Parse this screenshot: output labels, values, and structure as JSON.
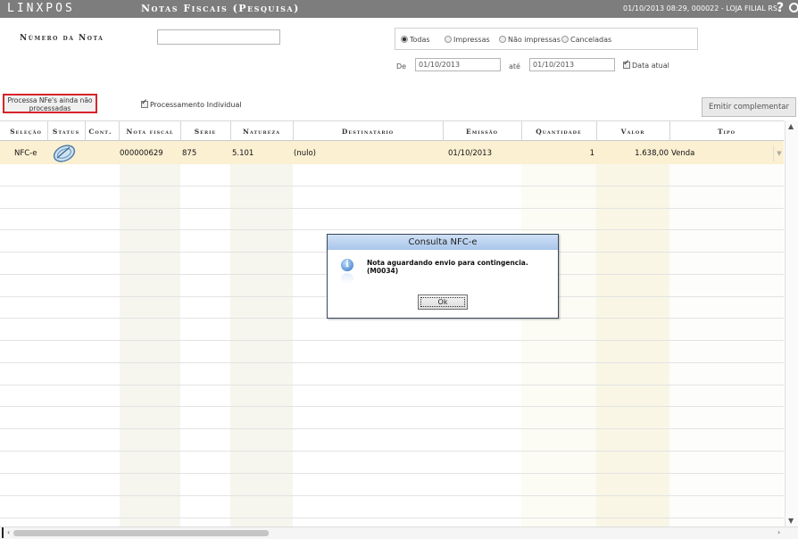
{
  "app": {
    "logo": "LINXPOS",
    "title": "Notas Fiscais (Pesquisa)",
    "info": "01/10/2013 08:29, 000022 - LOJA FILIAL RS."
  },
  "search": {
    "numero_label": "Número da Nota",
    "numero_value": ""
  },
  "filters": {
    "radios": [
      {
        "label": "Todas",
        "selected": true
      },
      {
        "label": "Impressas",
        "selected": false
      },
      {
        "label": "Não impressas",
        "selected": false
      },
      {
        "label": "Canceladas",
        "selected": false
      }
    ],
    "de_label": "De",
    "de_value": "01/10/2013",
    "ate_label": "até",
    "ate_value": "01/10/2013",
    "data_atual_label": "Data atual",
    "data_atual_checked": true
  },
  "actions": {
    "processa_label_line1": "Processa NFe's ainda não",
    "processa_label_line2": "processadas",
    "processamento_individual_label": "Processamento Individual",
    "processamento_individual_checked": true,
    "emitir_label": "Emitir complementar"
  },
  "table": {
    "headers": [
      "Seleção",
      "Status",
      "Cont.",
      "Nota fiscal",
      "Série",
      "Natureza",
      "Destinatário",
      "Emissão",
      "Quantidade",
      "Valor",
      "Tipo"
    ],
    "rows": [
      {
        "selecao": "NFC-e",
        "status_icon": "nfe-status-icon",
        "cont": "",
        "nota_fiscal": "000000629",
        "serie": "875",
        "natureza": "5.101",
        "destinatario": "(nulo)",
        "emissao": "01/10/2013",
        "quantidade": "1",
        "valor": "1.638,00",
        "tipo": "Venda"
      }
    ]
  },
  "dialog": {
    "title": "Consulta NFC-e",
    "message": "Nota aguardando envio para contingencia. (M0034)",
    "ok_label": "Ok",
    "icon": "info-icon"
  },
  "colors": {
    "titlebar": "#7d7d7d",
    "selected_row": "#fcf0d2",
    "highlight_border": "#d8232a",
    "dialog_title": "#a9c6ea"
  }
}
